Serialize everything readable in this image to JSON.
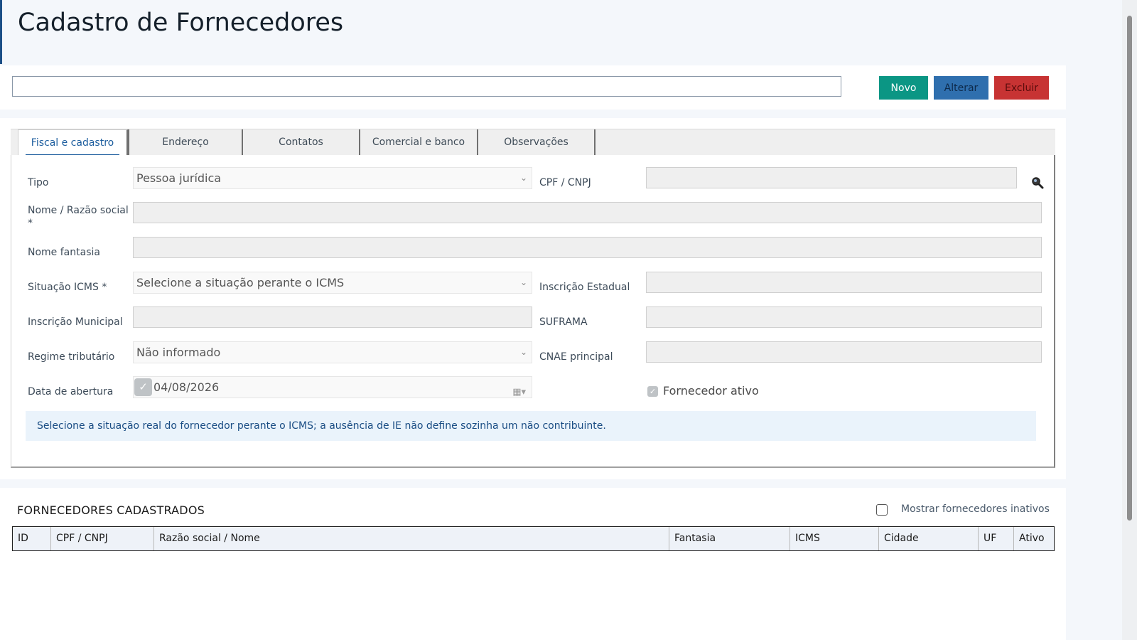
{
  "page": {
    "title": "Cadastro de Fornecedores"
  },
  "toolbar": {
    "search_value": "",
    "novo_label": "Novo",
    "alterar_label": "Alterar",
    "excluir_label": "Excluir"
  },
  "tabs": [
    {
      "label": "Fiscal e cadastro",
      "active": true
    },
    {
      "label": "Endereço",
      "active": false
    },
    {
      "label": "Contatos",
      "active": false
    },
    {
      "label": "Comercial e banco",
      "active": false
    },
    {
      "label": "Observações",
      "active": false
    }
  ],
  "form": {
    "tipo_label": "Tipo",
    "tipo_value": "Pessoa jurídica",
    "cpf_cnpj_label": "CPF / CNPJ",
    "nome_label": "Nome / Razão social *",
    "nome_fantasia_label": "Nome fantasia",
    "situacao_icms_label": "Situação ICMS *",
    "situacao_icms_value": "Selecione a situação perante o ICMS",
    "inscricao_estadual_label": "Inscrição Estadual",
    "inscricao_municipal_label": "Inscrição Municipal",
    "suframa_label": "SUFRAMA",
    "regime_label": "Regime tributário",
    "regime_value": "Não informado",
    "cnae_label": "CNAE principal",
    "data_abertura_label": "Data de abertura",
    "data_abertura_value": "04/08/2026",
    "ativo_label": "Fornecedor ativo",
    "ativo_checked": true,
    "info_text": "Selecione a situação real do fornecedor perante o ICMS; a ausência de IE não define sozinha um não contribuinte."
  },
  "list": {
    "title": "FORNECEDORES CADASTRADOS",
    "show_inactive_label": "Mostrar fornecedores inativos",
    "show_inactive_checked": false,
    "columns": [
      "ID",
      "CPF / CNPJ",
      "Razão social / Nome",
      "Fantasia",
      "ICMS",
      "Cidade",
      "UF",
      "Ativo"
    ]
  },
  "colors": {
    "novo": "#0b9684",
    "alterar": "#2f6fae",
    "excluir": "#c73333",
    "accent": "#1c5d9e"
  }
}
